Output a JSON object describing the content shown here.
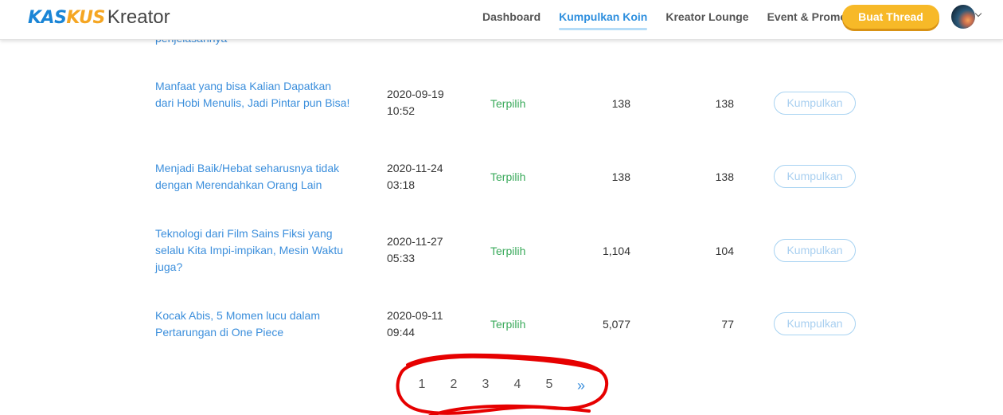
{
  "header": {
    "logo_part1": "KAS",
    "logo_part2": "KUS",
    "logo_suffix": "Kreator",
    "nav": [
      {
        "label": "Dashboard",
        "active": false
      },
      {
        "label": "Kumpulkan Koin",
        "active": true
      },
      {
        "label": "Kreator Lounge",
        "active": false
      },
      {
        "label": "Event & Promo",
        "active": false
      }
    ],
    "cta_label": "Buat Thread",
    "avatar_icon": "user-avatar",
    "caret_icon": "chevron-down-icon"
  },
  "partial_row_title": "penjelasannya",
  "rows": [
    {
      "title": "Manfaat yang bisa Kalian Dapatkan dari Hobi Menulis, Jadi Pintar pun Bisa!",
      "date": "2020-09-19",
      "time": "10:52",
      "status": "Terpilih",
      "value1": "138",
      "value2": "138",
      "action": "Kumpulkan"
    },
    {
      "title": "Menjadi Baik/Hebat seharusnya tidak dengan Merendahkan Orang Lain",
      "date": "2020-11-24",
      "time": "03:18",
      "status": "Terpilih",
      "value1": "138",
      "value2": "138",
      "action": "Kumpulkan"
    },
    {
      "title": "Teknologi dari Film Sains Fiksi yang selalu Kita Impi-impikan, Mesin Waktu juga?",
      "date": "2020-11-27",
      "time": "05:33",
      "status": "Terpilih",
      "value1": "1,104",
      "value2": "104",
      "action": "Kumpulkan"
    },
    {
      "title": "Kocak Abis, 5 Momen lucu dalam Pertarungan di One Piece",
      "date": "2020-09-11",
      "time": "09:44",
      "status": "Terpilih",
      "value1": "5,077",
      "value2": "77",
      "action": "Kumpulkan"
    }
  ],
  "pagination": {
    "pages": [
      "1",
      "2",
      "3",
      "4",
      "5"
    ],
    "next": "»"
  },
  "colors": {
    "accent": "#2e8fde",
    "cta": "#f7b928",
    "status": "#3aaa5b",
    "annotation": "#e60000"
  }
}
